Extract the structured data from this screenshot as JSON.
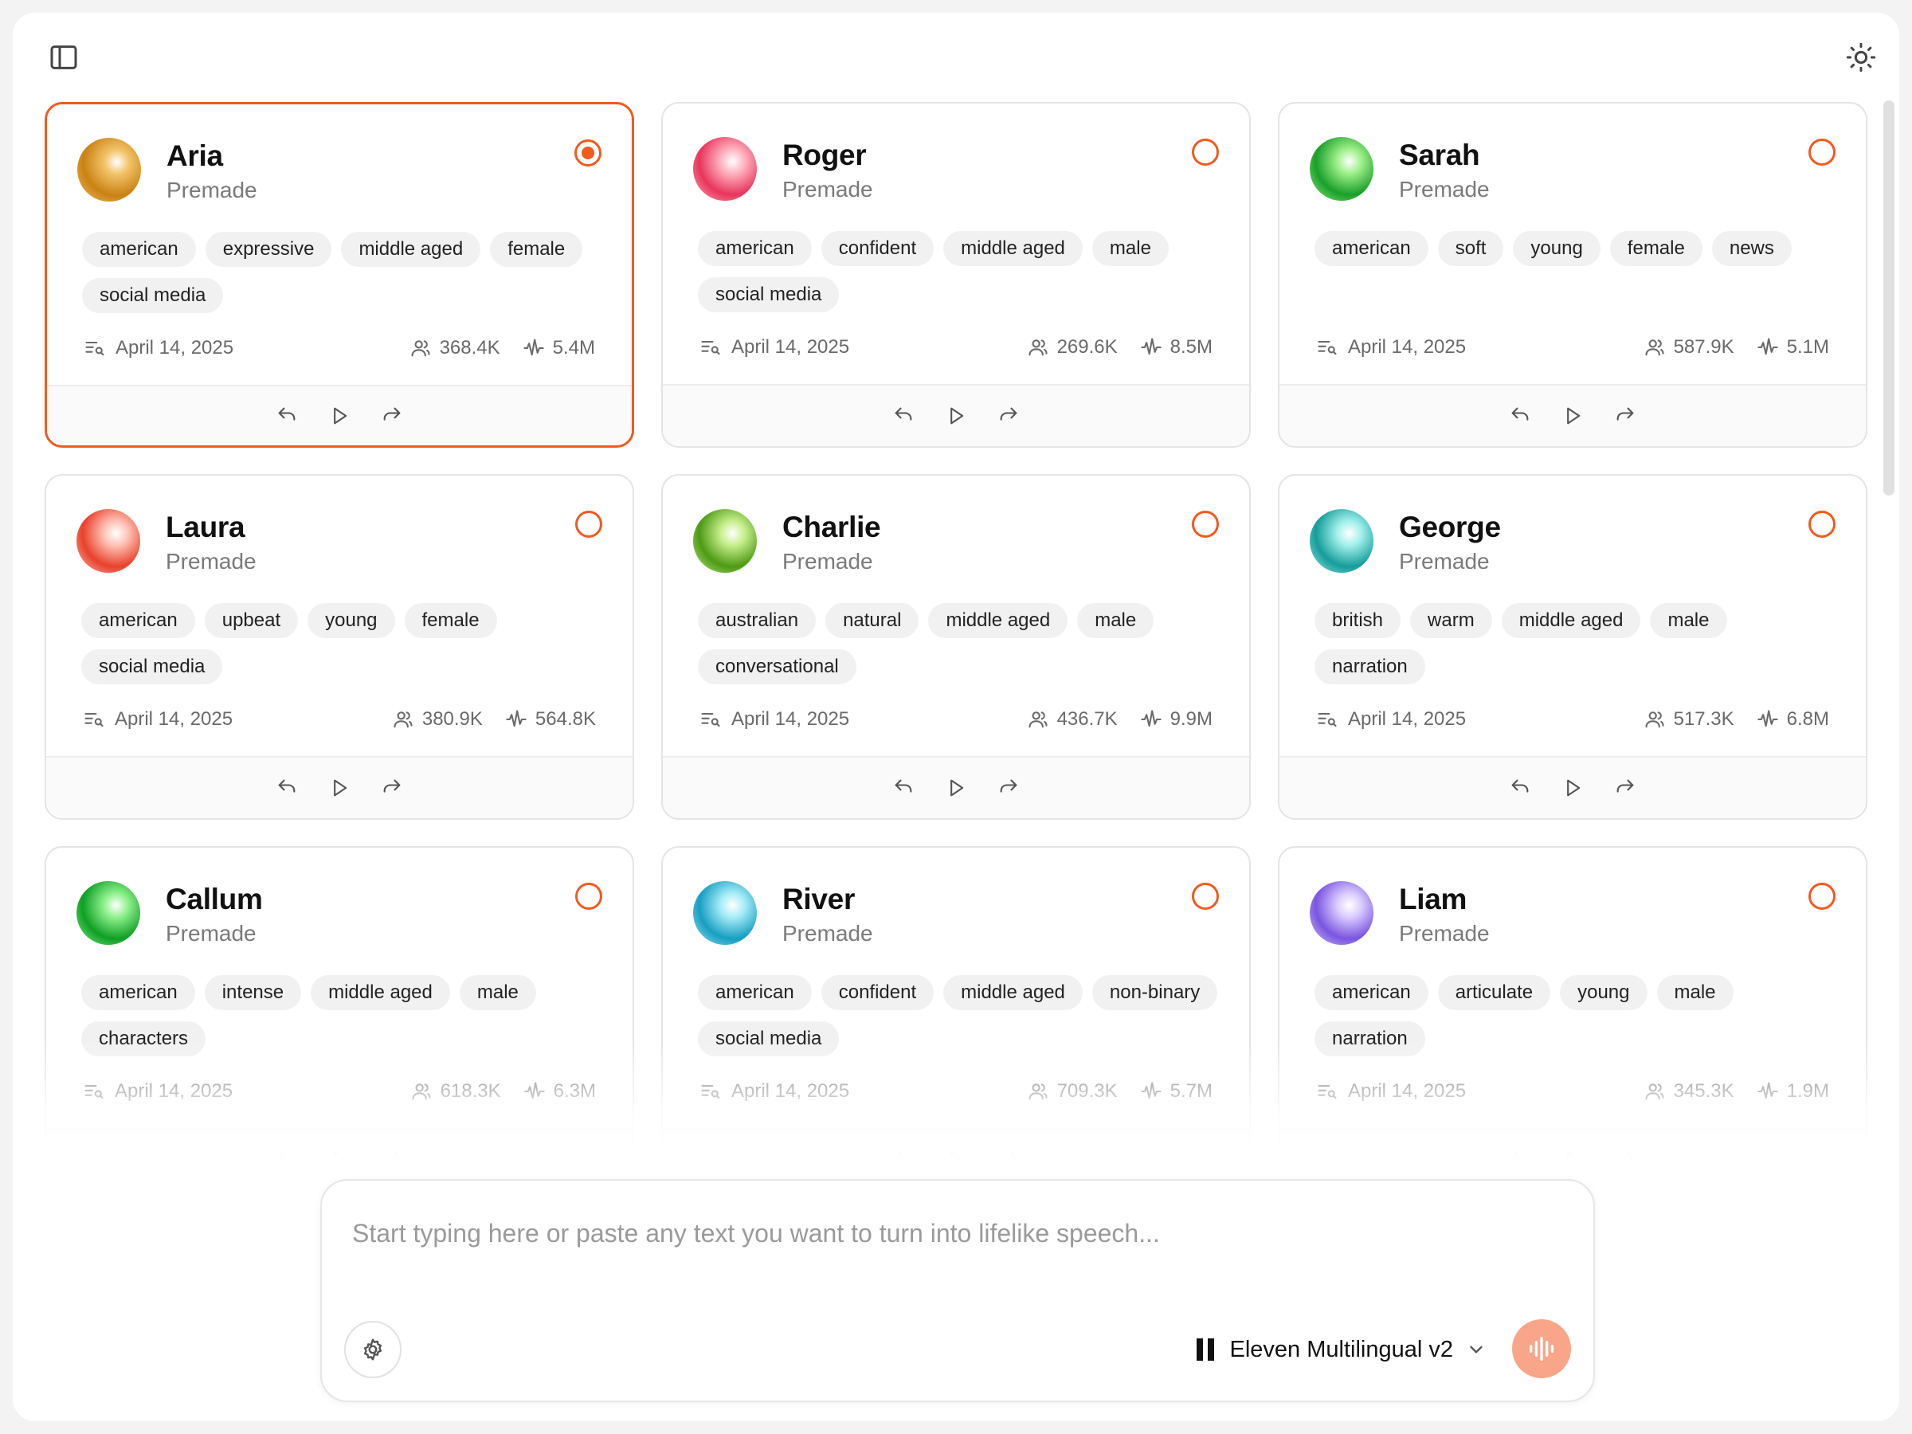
{
  "topbar": {
    "sidebar_icon": "sidebar-toggle-icon",
    "theme_icon": "sun-icon"
  },
  "voices": [
    {
      "name": "Aria",
      "category": "Premade",
      "selected": true,
      "tags": [
        "american",
        "expressive",
        "middle aged",
        "female",
        "social media"
      ],
      "date": "April 14, 2025",
      "users": "368.4K",
      "chars": "5.4M",
      "avatar_colors": [
        "#f3c36a",
        "#c98212"
      ]
    },
    {
      "name": "Roger",
      "category": "Premade",
      "selected": false,
      "tags": [
        "american",
        "confident",
        "middle aged",
        "male",
        "social media"
      ],
      "date": "April 14, 2025",
      "users": "269.6K",
      "chars": "8.5M",
      "avatar_colors": [
        "#ffb2c0",
        "#e8355c"
      ]
    },
    {
      "name": "Sarah",
      "category": "Premade",
      "selected": false,
      "tags": [
        "american",
        "soft",
        "young",
        "female",
        "news"
      ],
      "date": "April 14, 2025",
      "users": "587.9K",
      "chars": "5.1M",
      "avatar_colors": [
        "#9ff08b",
        "#1a9f2a"
      ]
    },
    {
      "name": "Laura",
      "category": "Premade",
      "selected": false,
      "tags": [
        "american",
        "upbeat",
        "young",
        "female",
        "social media"
      ],
      "date": "April 14, 2025",
      "users": "380.9K",
      "chars": "564.8K",
      "avatar_colors": [
        "#ffc2b6",
        "#e8412b"
      ]
    },
    {
      "name": "Charlie",
      "category": "Premade",
      "selected": false,
      "tags": [
        "australian",
        "natural",
        "middle aged",
        "male",
        "conversational"
      ],
      "date": "April 14, 2025",
      "users": "436.7K",
      "chars": "9.9M",
      "avatar_colors": [
        "#c7ee8c",
        "#4d9a14"
      ]
    },
    {
      "name": "George",
      "category": "Premade",
      "selected": false,
      "tags": [
        "british",
        "warm",
        "middle aged",
        "male",
        "narration"
      ],
      "date": "April 14, 2025",
      "users": "517.3K",
      "chars": "6.8M",
      "avatar_colors": [
        "#a3f0ec",
        "#159d9a"
      ]
    },
    {
      "name": "Callum",
      "category": "Premade",
      "selected": false,
      "tags": [
        "american",
        "intense",
        "middle aged",
        "male",
        "characters"
      ],
      "date": "April 14, 2025",
      "users": "618.3K",
      "chars": "6.3M",
      "avatar_colors": [
        "#8ef08c",
        "#0f9f25"
      ]
    },
    {
      "name": "River",
      "category": "Premade",
      "selected": false,
      "tags": [
        "american",
        "confident",
        "middle aged",
        "non-binary",
        "social media"
      ],
      "date": "April 14, 2025",
      "users": "709.3K",
      "chars": "5.7M",
      "avatar_colors": [
        "#a6ecf7",
        "#179ec2"
      ]
    },
    {
      "name": "Liam",
      "category": "Premade",
      "selected": false,
      "tags": [
        "american",
        "articulate",
        "young",
        "male",
        "narration"
      ],
      "date": "April 14, 2025",
      "users": "345.3K",
      "chars": "1.9M",
      "avatar_colors": [
        "#dacbff",
        "#7a55e0"
      ]
    }
  ],
  "composer": {
    "placeholder": "Start typing here or paste any text you want to turn into lifelike speech...",
    "model": "Eleven Multilingual v2"
  },
  "colors": {
    "accent": "#f25a1f",
    "generate": "#f9a58a"
  }
}
